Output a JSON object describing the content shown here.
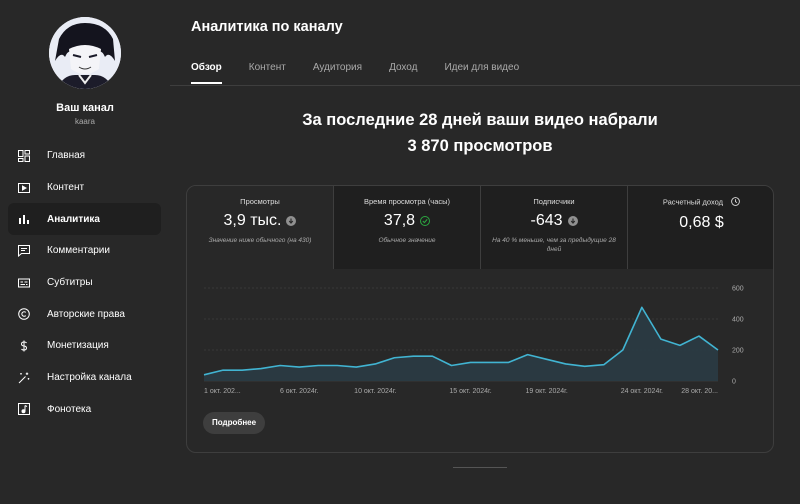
{
  "sidebar": {
    "channel_name": "Ваш канал",
    "channel_handle": "kaara",
    "items": [
      {
        "label": "Главная",
        "icon": "dashboard-icon"
      },
      {
        "label": "Контент",
        "icon": "content-icon"
      },
      {
        "label": "Аналитика",
        "icon": "analytics-icon",
        "active": true
      },
      {
        "label": "Комментарии",
        "icon": "comments-icon"
      },
      {
        "label": "Субтитры",
        "icon": "subtitles-icon"
      },
      {
        "label": "Авторские права",
        "icon": "copyright-icon"
      },
      {
        "label": "Монетизация",
        "icon": "dollar-icon"
      },
      {
        "label": "Настройка канала",
        "icon": "magic-wand-icon"
      },
      {
        "label": "Фонотека",
        "icon": "audio-library-icon"
      }
    ]
  },
  "header": {
    "title": "Аналитика по каналу"
  },
  "tabs": [
    {
      "label": "Обзор",
      "active": true
    },
    {
      "label": "Контент"
    },
    {
      "label": "Аудитория"
    },
    {
      "label": "Доход"
    },
    {
      "label": "Идеи для видео"
    }
  ],
  "summary": {
    "line1": "За последние 28 дней ваши видео набрали",
    "line2": "3 870 просмотров"
  },
  "metrics": [
    {
      "label": "Просмотры",
      "value": "3,9 тыс.",
      "note": "Значение ниже обычного (на 430)",
      "status": "down"
    },
    {
      "label": "Время просмотра (часы)",
      "value": "37,8",
      "note": "Обычное значение",
      "status": "ok"
    },
    {
      "label": "Подписчики",
      "value": "-643",
      "note": "На 40 % меньше, чем за предыдущие 28 дней",
      "status": "down"
    },
    {
      "label": "Расчетный доход",
      "value": "0,68 $",
      "note": "",
      "status": "info"
    }
  ],
  "colors": {
    "line": "#41b4d2",
    "fill": "#2a3b44",
    "grid": "#4a4a4a",
    "axis_text": "#aaaaaa",
    "ok": "#2ba640",
    "down_badge": "#909090"
  },
  "chart_data": {
    "type": "area",
    "x": [
      "1 окт. 2024 г.",
      "2 окт.",
      "3 окт.",
      "4 окт.",
      "5 окт.",
      "6 окт. 2024 г.",
      "7 окт.",
      "8 окт.",
      "9 окт.",
      "10 окт. 2024 г.",
      "11 окт.",
      "12 окт.",
      "13 окт.",
      "14 окт.",
      "15 окт. 2024 г.",
      "16 окт.",
      "17 окт.",
      "18 окт.",
      "19 окт. 2024 г.",
      "20 окт.",
      "21 окт.",
      "22 окт.",
      "23 окт.",
      "24 окт. 2024 г.",
      "25 окт.",
      "26 окт.",
      "27 окт.",
      "28 окт. 2024 г."
    ],
    "x_tick_labels": [
      "1 окт. 202...",
      "6 окт. 2024г.",
      "10 окт. 2024г.",
      "15 окт. 2024г.",
      "19 окт. 2024г.",
      "24 окт. 2024г.",
      "28 окт. 20..."
    ],
    "y_ticks": [
      "0",
      "200",
      "400",
      "600"
    ],
    "ylim": [
      0,
      600
    ],
    "series": [
      {
        "values": [
          40,
          70,
          70,
          80,
          100,
          90,
          100,
          100,
          90,
          110,
          150,
          160,
          160,
          100,
          120,
          120,
          120,
          170,
          140,
          110,
          95,
          105,
          200,
          475,
          270,
          230,
          290,
          200
        ]
      }
    ],
    "grid": true
  },
  "more_button": "Подробнее"
}
